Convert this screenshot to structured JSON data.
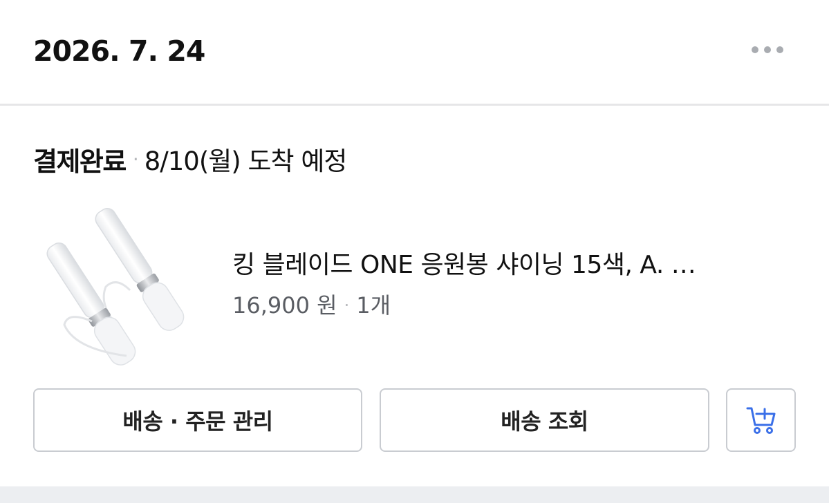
{
  "header": {
    "date": "2026. 7. 24",
    "more_icon": "more-horizontal-icon"
  },
  "order": {
    "status": "결제완료",
    "separator": "·",
    "arrival": "8/10(월) 도착 예정"
  },
  "product": {
    "image": "light-stick-product-image",
    "name": "킹 블레이드 ONE 응원봉 샤이닝 15색, A. …",
    "price": "16,900 원",
    "separator": "·",
    "quantity": "1개"
  },
  "buttons": {
    "manage_label": "배송 · 주문 관리",
    "track_label": "배송 조회",
    "cart_icon": "add-to-cart-icon"
  },
  "colors": {
    "accent": "#3a6fe8",
    "border": "#c9ccd1",
    "muted_text": "#5a5d63"
  }
}
